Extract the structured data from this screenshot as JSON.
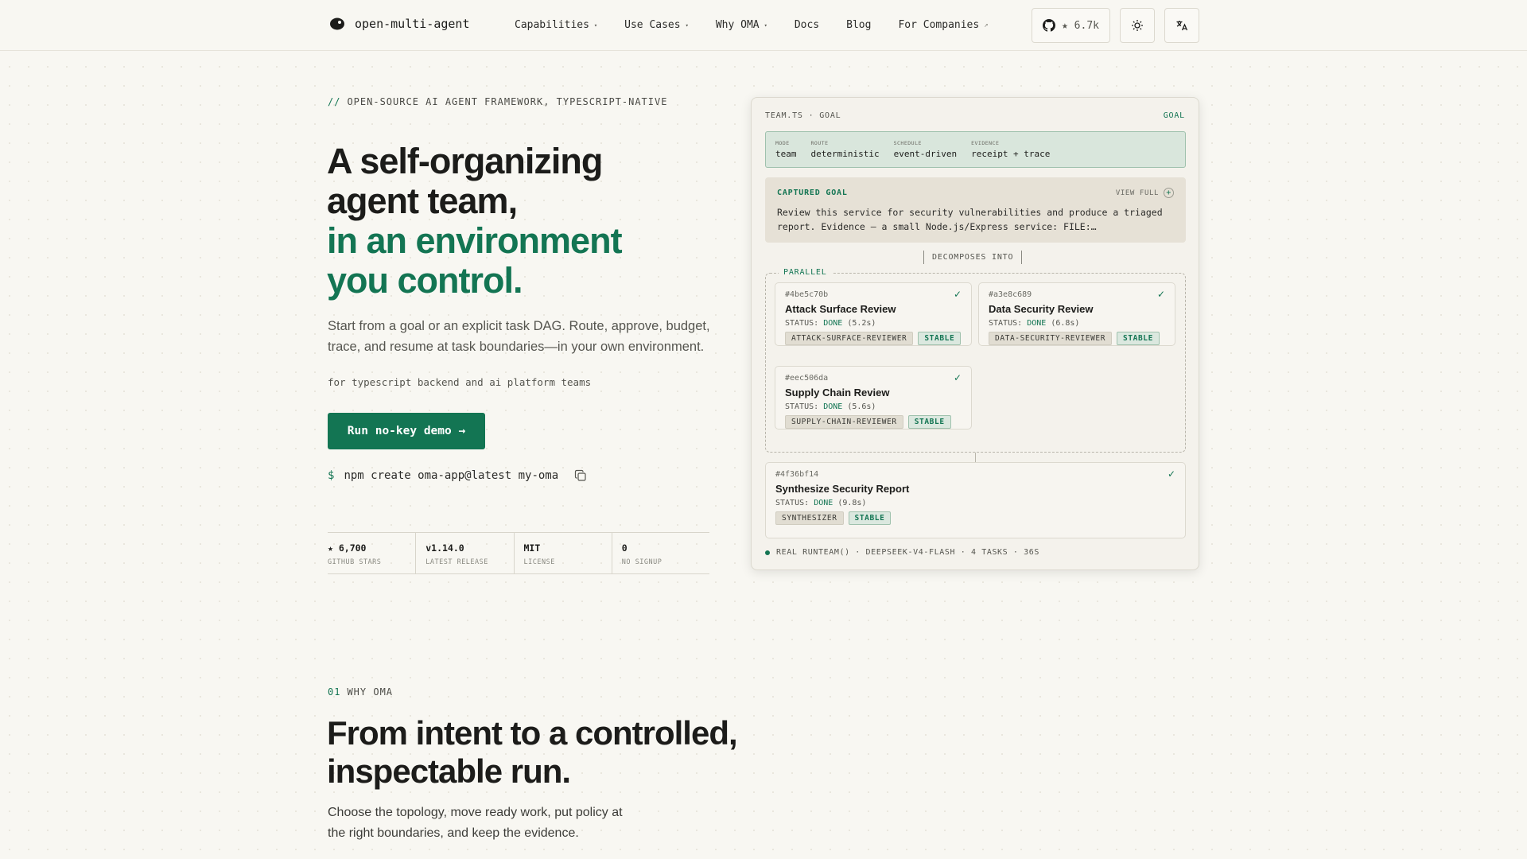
{
  "nav": {
    "brand": "open-multi-agent",
    "links": [
      {
        "label": "Capabilities",
        "caret": "▾"
      },
      {
        "label": "Use Cases",
        "caret": "▾"
      },
      {
        "label": "Why OMA",
        "caret": "▾"
      },
      {
        "label": "Docs"
      },
      {
        "label": "Blog"
      },
      {
        "label": "For Companies",
        "ext": "↗"
      }
    ],
    "github_stars": "★ 6.7k"
  },
  "hero": {
    "eyebrow_slashes": "//",
    "eyebrow": "OPEN-SOURCE AI AGENT FRAMEWORK, TYPESCRIPT-NATIVE",
    "title_line1": "A self-organizing",
    "title_line2": "agent team,",
    "title_line3": "in an environment",
    "title_line4": "you control.",
    "subtitle": "Start from a goal or an explicit task DAG. Route, approve, budget, trace, and resume at task boundaries—in your own environment.",
    "audience": "for typescript backend and ai platform teams",
    "cta_label": "Run no-key demo →",
    "cmd_prompt": "$",
    "cmd": "npm create oma-app@latest my-oma",
    "stats": [
      {
        "value": "★ 6,700",
        "label": "GITHUB STARS"
      },
      {
        "value": "v1.14.0",
        "label": "LATEST RELEASE"
      },
      {
        "value": "MIT",
        "label": "LICENSE"
      },
      {
        "value": "0",
        "label": "NO SIGNUP"
      }
    ]
  },
  "card": {
    "file": "TEAM.TS · GOAL",
    "mode_tag": "GOAL",
    "config": [
      {
        "key": "MODE",
        "value": "team"
      },
      {
        "key": "ROUTE",
        "value": "deterministic"
      },
      {
        "key": "SCHEDULE",
        "value": "event-driven"
      },
      {
        "key": "EVIDENCE",
        "value": "receipt + trace"
      }
    ],
    "captured_title": "CAPTURED GOAL",
    "view_full": "VIEW FULL",
    "captured_text": "Review this service for security vulnerabilities and produce a triaged report. Evidence — a small Node.js/Express service: FILE:…",
    "decomposes": "DECOMPOSES INTO",
    "parallel": "PARALLEL",
    "status_prefix": "STATUS:",
    "tasks": [
      {
        "id": "#4be5c70b",
        "title": "Attack Surface Review",
        "status": "DONE",
        "time": "(5.2s)",
        "role": "ATTACK-SURFACE-REVIEWER",
        "badge": "STABLE"
      },
      {
        "id": "#a3e8c689",
        "title": "Data Security Review",
        "status": "DONE",
        "time": "(6.8s)",
        "role": "DATA-SECURITY-REVIEWER",
        "badge": "STABLE"
      },
      {
        "id": "#eec506da",
        "title": "Supply Chain Review",
        "status": "DONE",
        "time": "(5.6s)",
        "role": "SUPPLY-CHAIN-REVIEWER",
        "badge": "STABLE"
      },
      {
        "id": "#4f36bf14",
        "title": "Synthesize Security Report",
        "status": "DONE",
        "time": "(9.8s)",
        "role": "SYNTHESIZER",
        "badge": "STABLE"
      }
    ],
    "footer": "REAL RUNTEAM() · DEEPSEEK-V4-FLASH · 4 TASKS · 36S"
  },
  "section": {
    "num": "01",
    "eyebrow": "WHY OMA",
    "title": "From intent to a controlled, inspectable run.",
    "subtitle": "Choose the topology, move ready work, put policy at the right boundaries, and keep the evidence."
  },
  "colors": {
    "accent": "#137553",
    "background": "#f8f7f2",
    "text": "#1c1c1a"
  }
}
